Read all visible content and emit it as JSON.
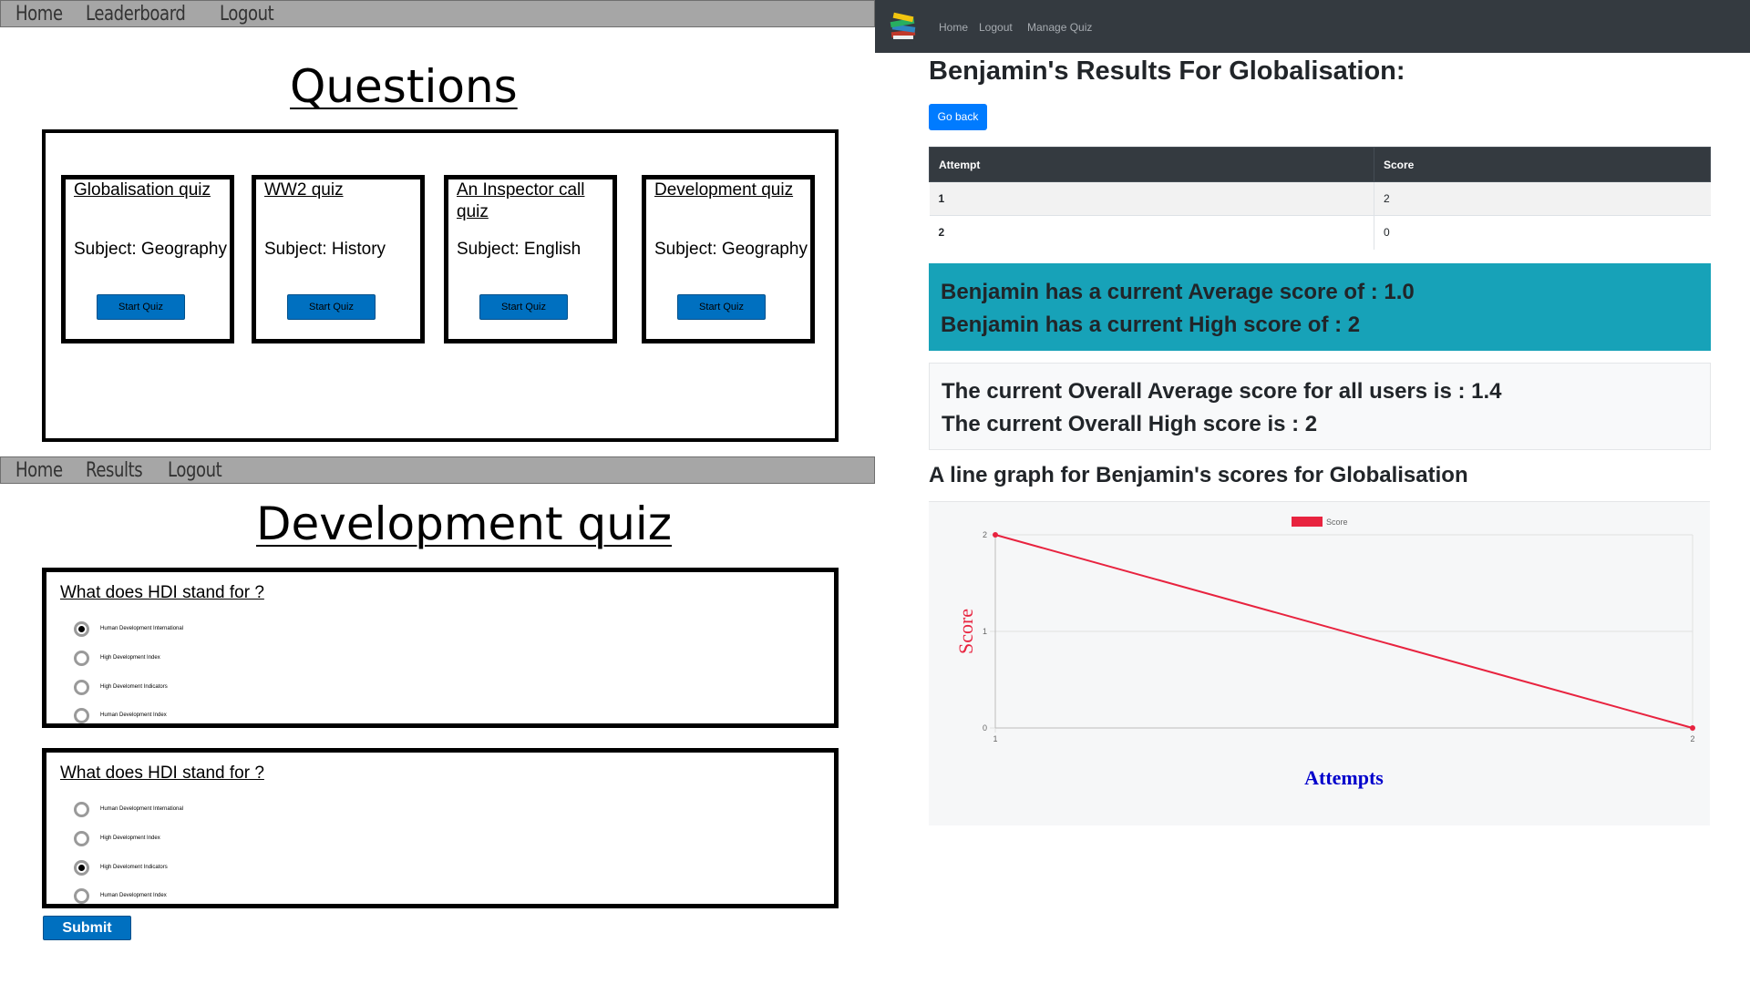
{
  "wireframe_top": {
    "nav": [
      "Home",
      "Leaderboard",
      "Logout"
    ],
    "title": "Questions",
    "quizzes": [
      {
        "name": "Globalisation quiz",
        "subject": "Subject: Geography",
        "button": "Start Quiz"
      },
      {
        "name": "WW2 quiz",
        "subject": "Subject: History",
        "button": "Start Quiz"
      },
      {
        "name": "An Inspector call quiz",
        "subject": "Subject: English",
        "button": "Start Quiz"
      },
      {
        "name": "Development quiz",
        "subject": "Subject: Geography",
        "button": "Start Quiz"
      }
    ]
  },
  "wireframe_bottom": {
    "nav": [
      "Home",
      "Results",
      "Logout"
    ],
    "title": "Development quiz",
    "questions": [
      {
        "text": "What does HDI stand for ?",
        "options": [
          "Human Development International",
          "High Development Index",
          "High Develoment Indicators",
          "Human Development Index"
        ],
        "selected": 0
      },
      {
        "text": "What does HDI stand for ?",
        "options": [
          "Human Development International",
          "High Development Index",
          "High Develoment Indicators",
          "Human Development Index"
        ],
        "selected": 2
      }
    ],
    "submit": "Submit"
  },
  "app": {
    "nav": {
      "home": "Home",
      "logout": "Logout",
      "manage": "Manage Quiz"
    },
    "logo_icon": "books-icon",
    "title": "Benjamin's Results For Globalisation:",
    "go_back": "Go back",
    "table": {
      "headers": [
        "Attempt",
        "Score"
      ],
      "rows": [
        [
          "1",
          "2"
        ],
        [
          "2",
          "0"
        ]
      ]
    },
    "user_stats": [
      "Benjamin has a current Average score of : 1.0",
      "Benjamin has a current High score of : 2"
    ],
    "overall_stats": [
      "The current Overall Average score for all users is : 1.4",
      "The current Overall High score is : 2"
    ],
    "graph_title": "A line graph for Benjamin's scores for Globalisation",
    "colors": {
      "nav": "#343a40",
      "primary": "#007bff",
      "info": "#17a2b8",
      "line": "#e8233f",
      "axis_title_x": "#0000cc",
      "axis_title_y": "#e8233f"
    }
  },
  "chart_data": {
    "type": "line",
    "x": [
      1,
      2
    ],
    "series": [
      {
        "name": "Score",
        "values": [
          2,
          0
        ]
      }
    ],
    "xlabel": "Attempts",
    "ylabel": "Score",
    "xticks": [
      "1",
      "2"
    ],
    "yticks": [
      "0",
      "1",
      "2"
    ],
    "ylim": [
      0,
      2
    ],
    "grid": true,
    "legend": "top-center"
  }
}
